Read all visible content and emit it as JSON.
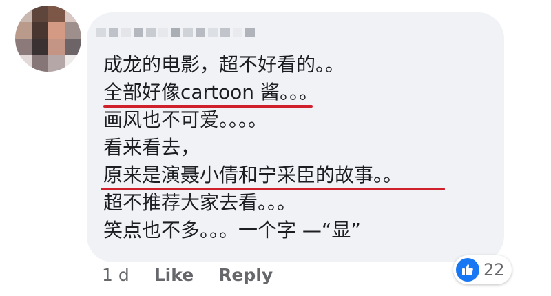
{
  "comment": {
    "lines": [
      "成龙的电影，超不好看的。。",
      "全部好像cartoon 酱。。。",
      "画风也不可爱。。。。",
      "看来看去，",
      "原来是演聂小倩和宁采臣的故事。。",
      "超不推荐大家去看。。。",
      "笑点也不多。。。一个字 —“显”"
    ],
    "highlight_color": "#d0202b"
  },
  "footer": {
    "time": "1 d",
    "like_label": "Like",
    "reply_label": "Reply"
  },
  "reactions": {
    "icon": "thumbs-up-icon",
    "count": "22",
    "color": "#1877f2"
  }
}
